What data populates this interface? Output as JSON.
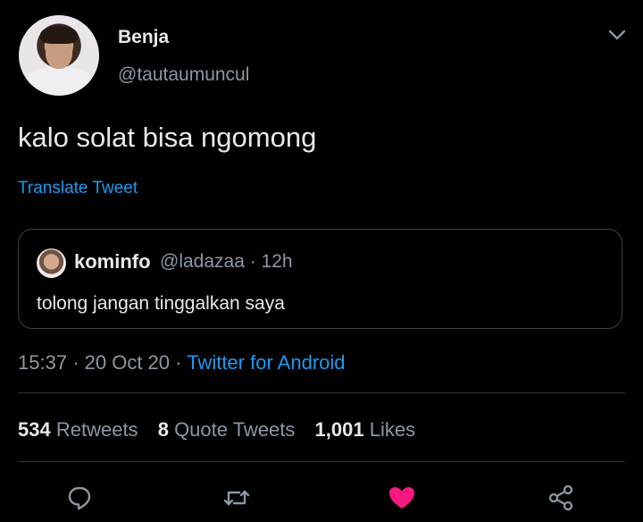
{
  "author": {
    "name": "Benja",
    "handle": "@tautaumuncul"
  },
  "tweet": {
    "text": "kalo solat bisa ngomong",
    "translate_label": "Translate Tweet"
  },
  "quote": {
    "name": "kominfo",
    "meta": "@ladazaa · 12h",
    "text": "tolong jangan tinggalkan saya"
  },
  "timestamp": {
    "time": "15:37",
    "date": "20 Oct 20",
    "source": "Twitter for Android"
  },
  "stats": {
    "retweets_count": "534",
    "retweets_label": "Retweets",
    "quotes_count": "8",
    "quotes_label": "Quote Tweets",
    "likes_count": "1,001",
    "likes_label": "Likes"
  },
  "icons": {
    "reply": "speech-bubble-icon",
    "retweet": "retweet-icon",
    "like": "heart-icon",
    "share": "share-icon",
    "menu": "chevron-down-icon"
  },
  "colors": {
    "background": "#000000",
    "link": "#1d9bf0",
    "like": "#f91880",
    "muted": "#8b98a5"
  }
}
